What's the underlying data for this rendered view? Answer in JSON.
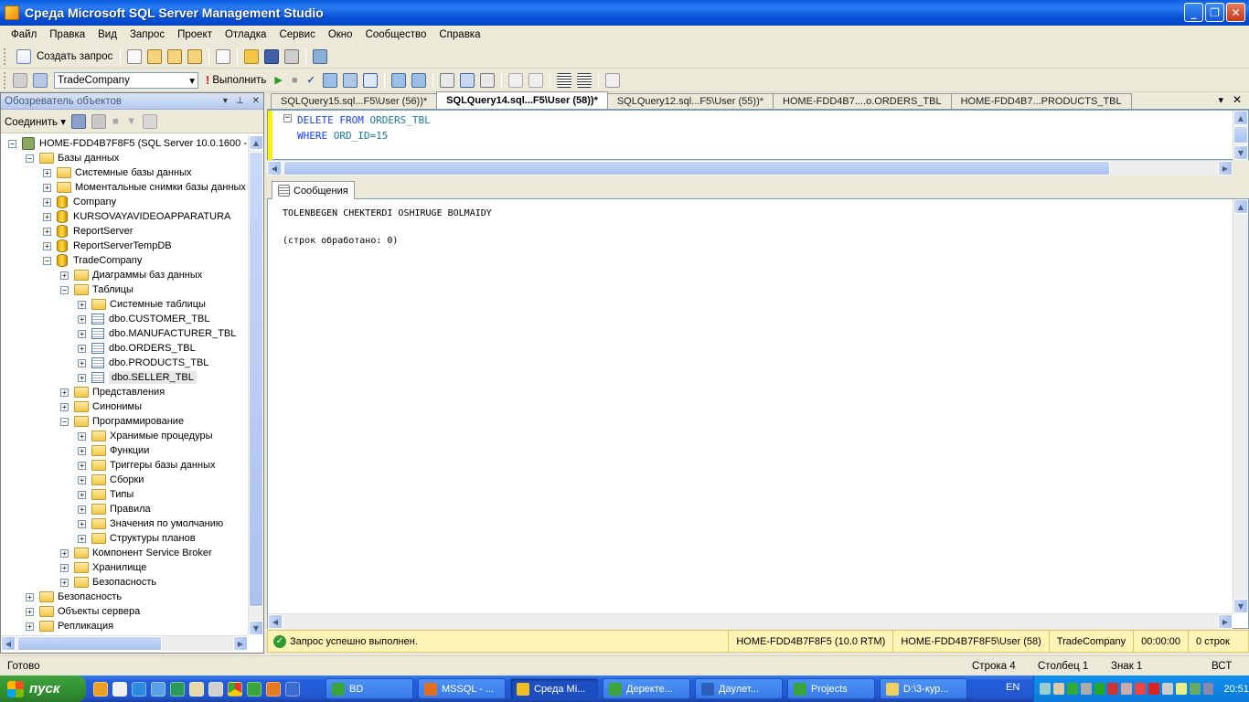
{
  "window": {
    "title": "Среда Microsoft SQL Server Management Studio",
    "buttons": [
      "_",
      "❐",
      "✕"
    ]
  },
  "menu": [
    "Файл",
    "Правка",
    "Вид",
    "Запрос",
    "Проект",
    "Отладка",
    "Сервис",
    "Окно",
    "Сообщество",
    "Справка"
  ],
  "toolbar1": {
    "new_query": "Создать запрос"
  },
  "toolbar2": {
    "database": "TradeCompany",
    "execute": "Выполнить"
  },
  "object_explorer": {
    "title": "Обозреватель объектов",
    "connect": "Соединить ▾",
    "tree": [
      {
        "label": "HOME-FDD4B7F8F5 (SQL Server 10.0.1600 - H",
        "level": 0,
        "exp": "−",
        "icon": "server"
      },
      {
        "label": "Базы данных",
        "level": 1,
        "exp": "−",
        "icon": "folder"
      },
      {
        "label": "Системные базы данных",
        "level": 2,
        "exp": "+",
        "icon": "folder"
      },
      {
        "label": "Моментальные снимки базы данных",
        "level": 2,
        "exp": "+",
        "icon": "folder"
      },
      {
        "label": "Company",
        "level": 2,
        "exp": "+",
        "icon": "db"
      },
      {
        "label": "KURSOVAYAVIDEOAPPARATURA",
        "level": 2,
        "exp": "+",
        "icon": "db"
      },
      {
        "label": "ReportServer",
        "level": 2,
        "exp": "+",
        "icon": "db"
      },
      {
        "label": "ReportServerTempDB",
        "level": 2,
        "exp": "+",
        "icon": "db"
      },
      {
        "label": "TradeCompany",
        "level": 2,
        "exp": "−",
        "icon": "db"
      },
      {
        "label": "Диаграммы баз данных",
        "level": 3,
        "exp": "+",
        "icon": "folder"
      },
      {
        "label": "Таблицы",
        "level": 3,
        "exp": "−",
        "icon": "folder"
      },
      {
        "label": "Системные таблицы",
        "level": 4,
        "exp": "+",
        "icon": "folder"
      },
      {
        "label": "dbo.CUSTOMER_TBL",
        "level": 4,
        "exp": "+",
        "icon": "table"
      },
      {
        "label": "dbo.MANUFACTURER_TBL",
        "level": 4,
        "exp": "+",
        "icon": "table"
      },
      {
        "label": "dbo.ORDERS_TBL",
        "level": 4,
        "exp": "+",
        "icon": "table"
      },
      {
        "label": "dbo.PRODUCTS_TBL",
        "level": 4,
        "exp": "+",
        "icon": "table"
      },
      {
        "label": "dbo.SELLER_TBL",
        "level": 4,
        "exp": "+",
        "icon": "table",
        "selected": true
      },
      {
        "label": "Представления",
        "level": 3,
        "exp": "+",
        "icon": "folder"
      },
      {
        "label": "Синонимы",
        "level": 3,
        "exp": "+",
        "icon": "folder"
      },
      {
        "label": "Программирование",
        "level": 3,
        "exp": "−",
        "icon": "folder"
      },
      {
        "label": "Хранимые процедуры",
        "level": 4,
        "exp": "+",
        "icon": "folder"
      },
      {
        "label": "Функции",
        "level": 4,
        "exp": "+",
        "icon": "folder"
      },
      {
        "label": "Триггеры базы данных",
        "level": 4,
        "exp": "+",
        "icon": "folder"
      },
      {
        "label": "Сборки",
        "level": 4,
        "exp": "+",
        "icon": "folder"
      },
      {
        "label": "Типы",
        "level": 4,
        "exp": "+",
        "icon": "folder"
      },
      {
        "label": "Правила",
        "level": 4,
        "exp": "+",
        "icon": "folder"
      },
      {
        "label": "Значения по умолчанию",
        "level": 4,
        "exp": "+",
        "icon": "folder"
      },
      {
        "label": "Структуры планов",
        "level": 4,
        "exp": "+",
        "icon": "folder"
      },
      {
        "label": "Компонент Service Broker",
        "level": 3,
        "exp": "+",
        "icon": "folder"
      },
      {
        "label": "Хранилище",
        "level": 3,
        "exp": "+",
        "icon": "folder"
      },
      {
        "label": "Безопасность",
        "level": 3,
        "exp": "+",
        "icon": "folder"
      },
      {
        "label": "Безопасность",
        "level": 1,
        "exp": "+",
        "icon": "folder"
      },
      {
        "label": "Объекты сервера",
        "level": 1,
        "exp": "+",
        "icon": "folder"
      },
      {
        "label": "Репликация",
        "level": 1,
        "exp": "+",
        "icon": "folder"
      }
    ]
  },
  "tabs": [
    {
      "label": "SQLQuery15.sql...F5\\User (56))*",
      "active": false
    },
    {
      "label": "SQLQuery14.sql...F5\\User (58))*",
      "active": true
    },
    {
      "label": "SQLQuery12.sql...F5\\User (55))*",
      "active": false
    },
    {
      "label": "HOME-FDD4B7....o.ORDERS_TBL",
      "active": false
    },
    {
      "label": "HOME-FDD4B7...PRODUCTS_TBL",
      "active": false
    }
  ],
  "editor": {
    "line1": {
      "kw1": "DELETE",
      "kw2": "FROM",
      "obj": "ORDERS_TBL"
    },
    "line2": {
      "kw": "WHERE",
      "expr": "ORD_ID=15"
    }
  },
  "messages": {
    "tab": "Сообщения",
    "text": "TOLENBEGEN CHEKTERDI OSHIRUGE BOLMAIDY\n\n(строк обработано: 0)"
  },
  "query_status": {
    "message": "Запрос успешно выполнен.",
    "server": "HOME-FDD4B7F8F5 (10.0 RTM)",
    "user": "HOME-FDD4B7F8F5\\User (58)",
    "database": "TradeCompany",
    "time": "00:00:00",
    "rows": "0 строк"
  },
  "statusbar": {
    "ready": "Готово",
    "row": "Строка 4",
    "col": "Столбец 1",
    "ch": "Знак 1",
    "mode": "ВСТ"
  },
  "taskbar": {
    "start": "пуск",
    "tasks": [
      {
        "label": "BD",
        "color": "#3aa53a",
        "active": false
      },
      {
        "label": "MSSQL - ...",
        "color": "#e07020",
        "active": false
      },
      {
        "label": "Среда Mi...",
        "color": "#f0c020",
        "active": true
      },
      {
        "label": "Деректе...",
        "color": "#3aa53a",
        "active": false
      },
      {
        "label": "Даулет...",
        "color": "#2b5fb8",
        "active": false
      },
      {
        "label": "Projects",
        "color": "#3aa53a",
        "active": false
      },
      {
        "label": "D:\\3-кур...",
        "color": "#f0d060",
        "active": false
      }
    ],
    "lang": "EN",
    "clock": "20:51"
  },
  "colors": {
    "keyword": "#1540ff",
    "identifier": "#1a7a9c",
    "status_bg": "#fcf3b4"
  }
}
